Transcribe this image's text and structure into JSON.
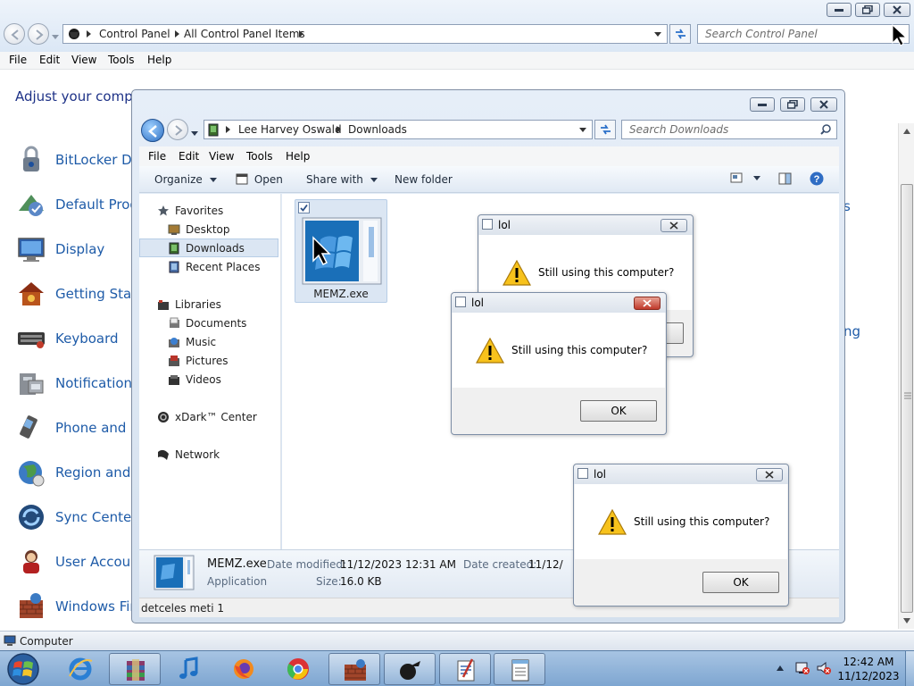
{
  "control_panel": {
    "window_buttons": {
      "minimize": "minimize",
      "maximize": "maximize",
      "close": "close"
    },
    "breadcrumb": [
      "Control Panel",
      "All Control Panel Items"
    ],
    "search_placeholder": "Search Control Panel",
    "menu": [
      "File",
      "Edit",
      "View",
      "Tools",
      "Help"
    ],
    "heading": "Adjust your compu",
    "items": [
      {
        "label": "BitLocker Dr",
        "icon": "lock-icon"
      },
      {
        "label": "Default Prog",
        "icon": "default-programs-icon"
      },
      {
        "label": "Display",
        "icon": "display-icon"
      },
      {
        "label": "Getting Start",
        "icon": "getting-started-icon"
      },
      {
        "label": "Keyboard",
        "icon": "keyboard-icon"
      },
      {
        "label": "Notification ",
        "icon": "notification-icon"
      },
      {
        "label": "Phone and M",
        "icon": "phone-icon"
      },
      {
        "label": "Region and ",
        "icon": "globe-icon"
      },
      {
        "label": "Sync Center",
        "icon": "sync-icon"
      },
      {
        "label": "User Accoun",
        "icon": "user-icon"
      },
      {
        "label": "Windows Fir",
        "icon": "firewall-icon"
      }
    ],
    "right_fragments": [
      "s",
      "ng"
    ],
    "status_label": "Computer"
  },
  "explorer": {
    "breadcrumb": [
      "Lee Harvey Oswald",
      "Downloads"
    ],
    "search_placeholder": "Search Downloads",
    "menu": [
      "File",
      "Edit",
      "View",
      "Tools",
      "Help"
    ],
    "toolbar": {
      "organize": "Organize",
      "open": "Open",
      "share_with": "Share with",
      "new_folder": "New folder"
    },
    "nav": {
      "favorites_header": "Favorites",
      "favorites": [
        "Desktop",
        "Downloads",
        "Recent Places"
      ],
      "libraries_header": "Libraries",
      "libraries": [
        "Documents",
        "Music",
        "Pictures",
        "Videos"
      ],
      "xdark": "xDark™ Center",
      "network": "Network"
    },
    "selected_nav": "Downloads",
    "file": {
      "name": "MEMZ.exe",
      "checked": true
    },
    "details": {
      "name": "MEMZ.exe",
      "type": "Application",
      "date_modified_label": "Date modified:",
      "date_modified": "11/12/2023 12:31 AM",
      "date_created_label": "Date created:",
      "date_created": "11/12/",
      "size_label": "Size:",
      "size": "16.0 KB"
    },
    "status_text": "detceles meti 1"
  },
  "dialogs": [
    {
      "title": "lol",
      "message": "Still using this computer?",
      "ok": "OK"
    },
    {
      "title": "lol",
      "message": "Still using this computer?",
      "ok": "OK"
    },
    {
      "title": "lol",
      "message": "Still using this computer?",
      "ok": "OK"
    }
  ],
  "taskbar": {
    "apps": [
      "internet-explorer",
      "winrar",
      "itunes",
      "firefox",
      "chrome",
      "control-panel",
      "memz",
      "wordpad",
      "notepad"
    ],
    "clock_time": "12:42 AM",
    "clock_date": "11/12/2023"
  },
  "colors": {
    "link": "#1e5ba8",
    "heading": "#1e3287",
    "taskbar": "#8fb3da",
    "selection": "#dbe6f3"
  }
}
